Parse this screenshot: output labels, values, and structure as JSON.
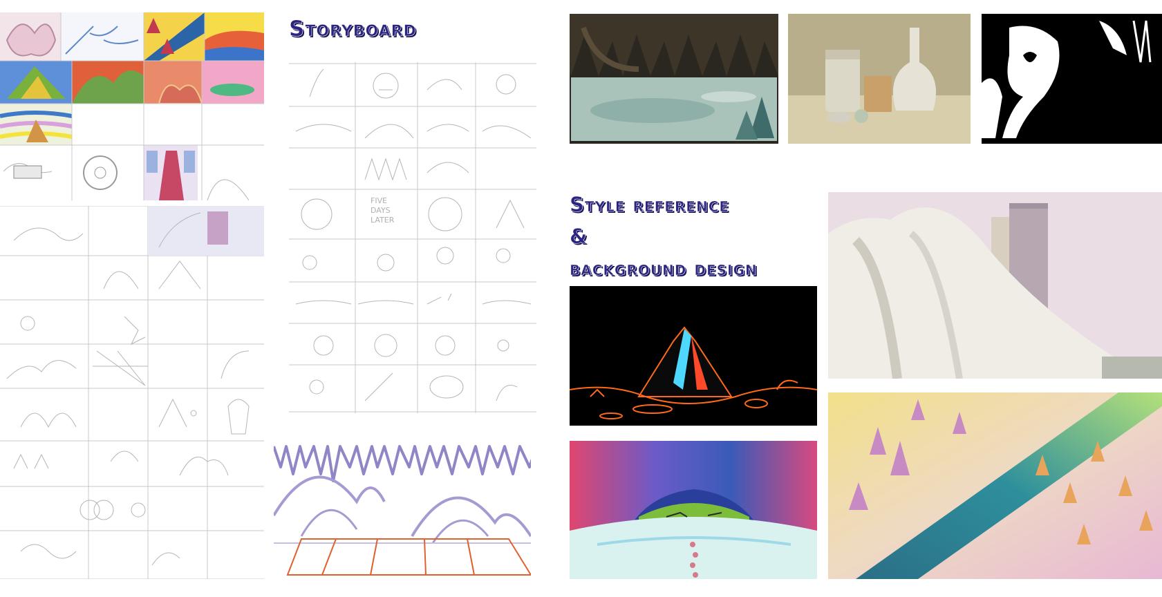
{
  "headings": {
    "storyboard": "Storyboard",
    "style_line_1": "Style reference",
    "style_line_2": "&",
    "style_line_3": "background design"
  },
  "sketch_text": {
    "five_days_later_1": "FIVE",
    "five_days_later_2": "DAYS",
    "five_days_later_3": "LATER"
  },
  "colors": {
    "heading_fill": "#2b2580",
    "heading_stroke": "#ffffff",
    "heading_shadow": "#17125a",
    "volcano_lava": "#ff6a1a",
    "volcano_cyan": "#4fd8ff",
    "cave_magenta": "#e0466f",
    "cave_blue": "#3a5bb8",
    "river_teal": "#2e8f9c",
    "river_yellow": "#f2e08a"
  },
  "images": [
    {
      "name": "color-thumbnails"
    },
    {
      "name": "storyboard-sheet-left"
    },
    {
      "name": "storyboard-sheet-center"
    },
    {
      "name": "cave-stalactite-line-drawing"
    },
    {
      "name": "cave-lake-painting"
    },
    {
      "name": "still-life-bottles-painting"
    },
    {
      "name": "black-white-silhouette"
    },
    {
      "name": "white-mountain-towers-background"
    },
    {
      "name": "volcano-neon-background"
    },
    {
      "name": "colored-pencil-cave-background"
    },
    {
      "name": "river-pastel-background"
    }
  ]
}
